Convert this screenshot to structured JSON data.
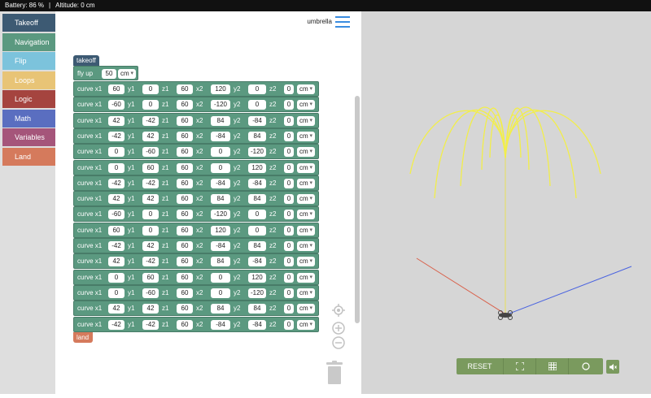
{
  "status": {
    "battery": "Battery: 86 %",
    "divider": "|",
    "altitude": "Altitude: 0 cm"
  },
  "sidebar": {
    "items": [
      {
        "label": "Takeoff",
        "color": "#3d5a73"
      },
      {
        "label": "Navigation",
        "color": "#5b9980"
      },
      {
        "label": "Flip",
        "color": "#7cc3dc"
      },
      {
        "label": "Loops",
        "color": "#e8c476"
      },
      {
        "label": "Logic",
        "color": "#a5443f"
      },
      {
        "label": "Math",
        "color": "#5a6ec0"
      },
      {
        "label": "Variables",
        "color": "#a5557a"
      },
      {
        "label": "Land",
        "color": "#d57a5c"
      }
    ]
  },
  "header": {
    "menu_label": "umbrella"
  },
  "program": {
    "takeoff_label": "takeoff",
    "flyup": {
      "label": "fly up",
      "value": "50",
      "unit": "cm"
    },
    "curve_label": "curve x1",
    "labels": {
      "y1": "y1",
      "z1": "z1",
      "x2": "x2",
      "y2": "y2",
      "z2": "z2"
    },
    "curves": [
      {
        "x1": "60",
        "y1": "0",
        "z1": "60",
        "x2": "120",
        "y2": "0",
        "z2": "0",
        "unit": "cm"
      },
      {
        "x1": "-60",
        "y1": "0",
        "z1": "60",
        "x2": "-120",
        "y2": "0",
        "z2": "0",
        "unit": "cm"
      },
      {
        "x1": "42",
        "y1": "-42",
        "z1": "60",
        "x2": "84",
        "y2": "-84",
        "z2": "0",
        "unit": "cm"
      },
      {
        "x1": "-42",
        "y1": "42",
        "z1": "60",
        "x2": "-84",
        "y2": "84",
        "z2": "0",
        "unit": "cm"
      },
      {
        "x1": "0",
        "y1": "-60",
        "z1": "60",
        "x2": "0",
        "y2": "-120",
        "z2": "0",
        "unit": "cm"
      },
      {
        "x1": "0",
        "y1": "60",
        "z1": "60",
        "x2": "0",
        "y2": "120",
        "z2": "0",
        "unit": "cm"
      },
      {
        "x1": "-42",
        "y1": "-42",
        "z1": "60",
        "x2": "-84",
        "y2": "-84",
        "z2": "0",
        "unit": "cm"
      },
      {
        "x1": "42",
        "y1": "42",
        "z1": "60",
        "x2": "84",
        "y2": "84",
        "z2": "0",
        "unit": "cm"
      },
      {
        "x1": "-60",
        "y1": "0",
        "z1": "60",
        "x2": "-120",
        "y2": "0",
        "z2": "0",
        "unit": "cm"
      },
      {
        "x1": "60",
        "y1": "0",
        "z1": "60",
        "x2": "120",
        "y2": "0",
        "z2": "0",
        "unit": "cm"
      },
      {
        "x1": "-42",
        "y1": "42",
        "z1": "60",
        "x2": "-84",
        "y2": "84",
        "z2": "0",
        "unit": "cm"
      },
      {
        "x1": "42",
        "y1": "-42",
        "z1": "60",
        "x2": "84",
        "y2": "-84",
        "z2": "0",
        "unit": "cm"
      },
      {
        "x1": "0",
        "y1": "60",
        "z1": "60",
        "x2": "0",
        "y2": "120",
        "z2": "0",
        "unit": "cm"
      },
      {
        "x1": "0",
        "y1": "-60",
        "z1": "60",
        "x2": "0",
        "y2": "-120",
        "z2": "0",
        "unit": "cm"
      },
      {
        "x1": "42",
        "y1": "42",
        "z1": "60",
        "x2": "84",
        "y2": "84",
        "z2": "0",
        "unit": "cm"
      },
      {
        "x1": "-42",
        "y1": "-42",
        "z1": "60",
        "x2": "-84",
        "y2": "-84",
        "z2": "0",
        "unit": "cm"
      }
    ],
    "land_label": "land"
  },
  "workspace_controls": [
    "recenter-icon",
    "zoom-in-icon",
    "zoom-out-icon",
    "trash-icon"
  ],
  "simulator": {
    "reset_label": "RESET",
    "icons": [
      "fullscreen-icon",
      "grid-icon",
      "circle-icon",
      "sound-icon"
    ],
    "path_color": "#f2ee4a",
    "axis_colors": {
      "red": "#d9604a",
      "blue": "#4a63e0",
      "yellow": "#e8e05a"
    }
  }
}
